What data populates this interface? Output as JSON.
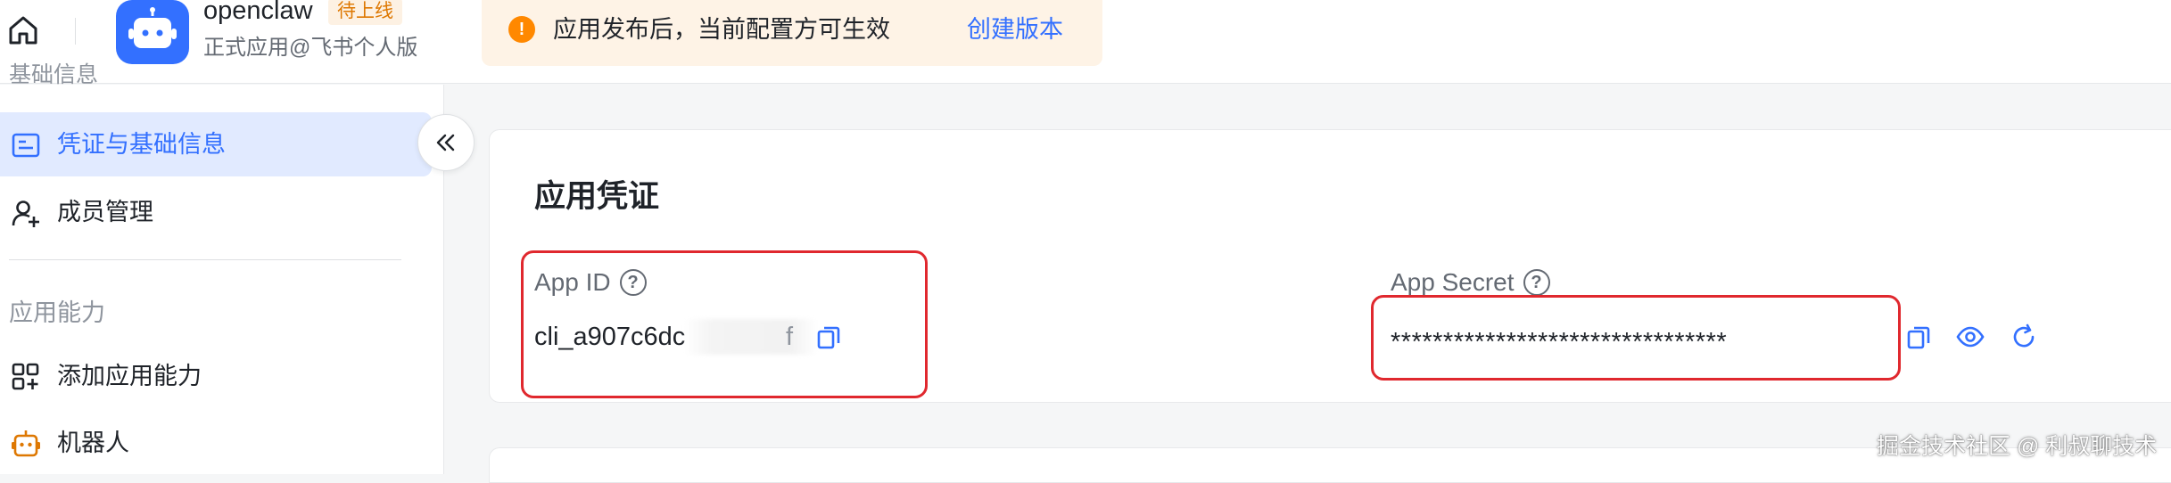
{
  "header": {
    "app_name": "openclaw",
    "app_status_badge": "待上线",
    "app_subtitle": "正式应用@飞书个人版",
    "notice_text": "应用发布后，当前配置方可生效",
    "notice_link": "创建版本"
  },
  "sidebar": {
    "partial_section": "基础信息",
    "items": [
      {
        "label": "凭证与基础信息",
        "icon": "credential-icon",
        "active": true
      },
      {
        "label": "成员管理",
        "icon": "member-add-icon",
        "active": false
      }
    ],
    "section_title": "应用能力",
    "capability_items": [
      {
        "label": "添加应用能力",
        "icon": "app-grid-add-icon"
      },
      {
        "label": "机器人",
        "icon": "robot-icon"
      }
    ]
  },
  "credentials": {
    "title": "应用凭证",
    "app_id_label": "App ID",
    "app_id_value": "cli_a907c6dc",
    "app_id_tail": "f",
    "app_secret_label": "App Secret",
    "app_secret_value": "********************************"
  },
  "watermark": "掘金技术社区 @ 利叔聊技术",
  "colors": {
    "accent": "#3370ff",
    "active_bg": "#e1eaff",
    "badge_text": "#de7802",
    "notice_bg": "#fef3e6",
    "notice_icon": "#ff8800",
    "annotation_red": "#e0282e"
  }
}
